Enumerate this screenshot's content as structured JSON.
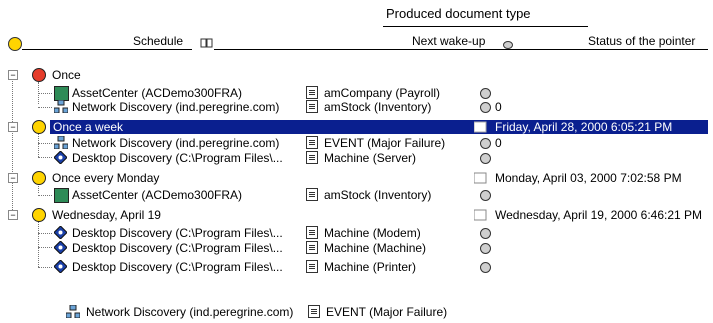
{
  "header": {
    "group_title": "Produced document type",
    "col_schedule": "Schedule",
    "col_wakeup": "Next wake-up",
    "col_status": "Status of the pointer"
  },
  "tree": {
    "once": {
      "label": "Once",
      "rows": [
        {
          "name": "AssetCenter (ACDemo300FRA)",
          "doc": "amCompany (Payroll)",
          "status": ""
        },
        {
          "name": "Network Discovery (ind.peregrine.com)",
          "doc": "amStock (Inventory)",
          "status": "0"
        }
      ]
    },
    "weekly": {
      "label": "Once a week",
      "wakeup": "Friday, April 28, 2000 6:05:21 PM",
      "rows": [
        {
          "name": "Network Discovery (ind.peregrine.com)",
          "doc": "EVENT (Major Failure)",
          "status": "0"
        },
        {
          "name": "Desktop Discovery (C:\\Program Files\\...",
          "doc": "Machine (Server)",
          "status": ""
        }
      ]
    },
    "monday": {
      "label": "Once every Monday",
      "wakeup": "Monday, April 03, 2000 7:02:58 PM",
      "rows": [
        {
          "name": "AssetCenter (ACDemo300FRA)",
          "doc": "amStock (Inventory)",
          "status": ""
        }
      ]
    },
    "wednesday": {
      "label": "Wednesday, April 19",
      "wakeup": "Wednesday, April 19, 2000 6:46:21 PM",
      "rows": [
        {
          "name": "Desktop Discovery (C:\\Program Files\\...",
          "doc": "Machine (Modem)",
          "status": ""
        },
        {
          "name": "Desktop Discovery (C:\\Program Files\\...",
          "doc": "Machine (Machine)",
          "status": ""
        },
        {
          "name": "Desktop Discovery (C:\\Program Files\\...",
          "doc": "Machine (Printer)",
          "status": ""
        }
      ]
    }
  },
  "footer": {
    "name": "Network Discovery (ind.peregrine.com)",
    "doc": "EVENT (Major Failure)"
  }
}
